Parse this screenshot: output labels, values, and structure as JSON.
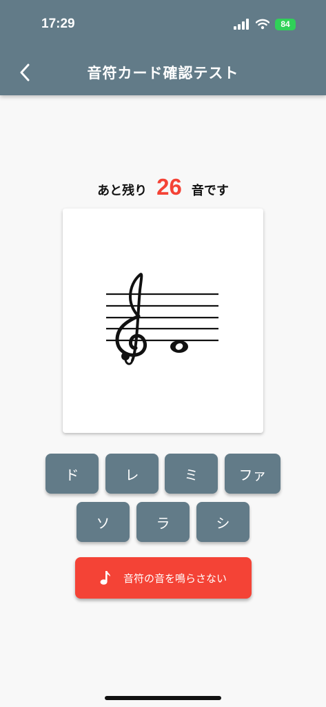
{
  "status_bar": {
    "time": "17:29",
    "battery": "84"
  },
  "header": {
    "title": "音符カード確認テスト"
  },
  "remaining": {
    "prefix": "あと残り",
    "count": "26",
    "suffix": "音です"
  },
  "answers": [
    "ド",
    "レ",
    "ミ",
    "ファ",
    "ソ",
    "ラ",
    "シ"
  ],
  "sound_button": {
    "label": "音符の音を鳴らさない"
  },
  "colors": {
    "header": "#627b88",
    "accent": "#f44336",
    "button": "#627b88"
  },
  "icons": [
    "chevron-left-icon",
    "signal-icon",
    "wifi-icon",
    "battery-icon",
    "music-note-icon",
    "treble-clef-icon",
    "whole-note-icon"
  ]
}
